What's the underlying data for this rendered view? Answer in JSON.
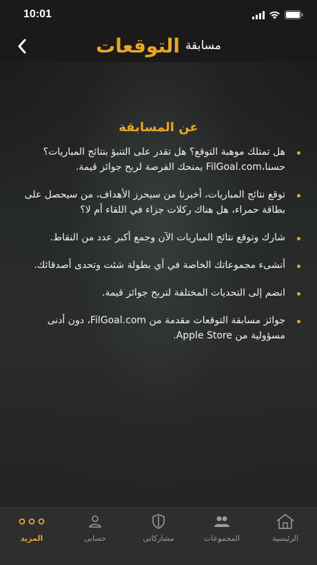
{
  "status": {
    "time": "10:01"
  },
  "header": {
    "title_small": "مسابقة",
    "title_big": "التوقعات"
  },
  "about": {
    "title": "عن المسابقة",
    "items": [
      "هل تمتلك موهبة التوقع؟ هل تقدر على التنبؤ بنتائج المباريات؟ حسنا،FilGoal.com يمنحك الفرصة لربح جوائز قيمة.",
      "توقع نتائج المباريات، أخبرنا من سيحرز الأهداف، من سيحصل على بطاقة حمراء، هل هناك ركلات جزاء في اللقاء أم لا؟",
      "شارك وتوقع نتائج المباريات الآن وجمع أكبر عدد من النقاط.",
      "أنشىء مجموعاتك الخاصة في أي بطولة شئت وتحدى أصدقائك.",
      "انضم إلى التحديات المختلفة لتربح جوائز قيمة.",
      "جوائز مسابقة التوقعات مقدمة من FilGoal.com، دون أدنى مسؤولية من     Apple Store."
    ]
  },
  "tabs": [
    {
      "label": "الرئيسية",
      "icon": "home-icon",
      "active": false
    },
    {
      "label": "المجموعات",
      "icon": "groups-icon",
      "active": false
    },
    {
      "label": "مشاركاتى",
      "icon": "shield-icon",
      "active": false
    },
    {
      "label": "حسابى",
      "icon": "user-icon",
      "active": false
    },
    {
      "label": "المزيد",
      "icon": "more-icon",
      "active": true
    }
  ],
  "colors": {
    "accent": "#e8a628",
    "tabbar": "#2e2e2e",
    "background": "#1a1a1a"
  }
}
